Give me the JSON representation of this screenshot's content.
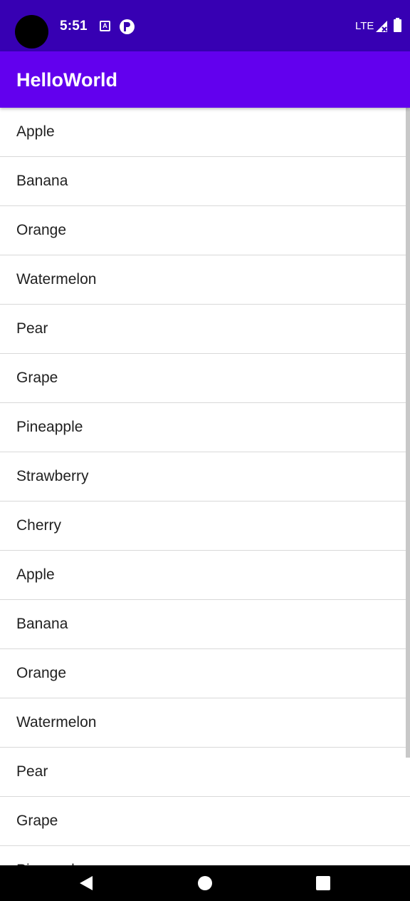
{
  "status_bar": {
    "time": "5:51",
    "network": "LTE",
    "icons": [
      "camera-hole",
      "notification-a-icon",
      "notification-p-icon",
      "signal-icon",
      "battery-icon"
    ]
  },
  "app_bar": {
    "title": "HelloWorld",
    "color": "#6200ee",
    "status_color": "#3700b3"
  },
  "list": {
    "items": [
      "Apple",
      "Banana",
      "Orange",
      "Watermelon",
      "Pear",
      "Grape",
      "Pineapple",
      "Strawberry",
      "Cherry",
      "Apple",
      "Banana",
      "Orange",
      "Watermelon",
      "Pear",
      "Grape",
      "Pineapple"
    ]
  },
  "nav_bar": {
    "buttons": [
      "back-icon",
      "home-icon",
      "recents-icon"
    ]
  }
}
